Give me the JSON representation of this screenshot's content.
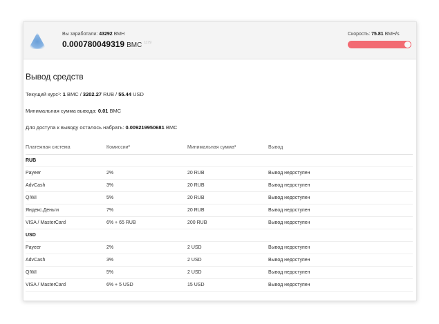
{
  "header": {
    "earned_label": "Вы заработали:",
    "earned_value": "43292",
    "earned_unit": "BMH",
    "balance_value": "0.000780049319",
    "balance_unit": "BMC",
    "balance_sup": "1179",
    "speed_label": "Скорость:",
    "speed_value": "75.81",
    "speed_unit": "BMH/s",
    "speed_bar_color": "#f26a72"
  },
  "page": {
    "title": "Вывод средств",
    "rate_label": "Текущий курс¹:",
    "rate_bmc": "1",
    "rate_bmc_unit": "BMC /",
    "rate_rub": "3202.27",
    "rate_rub_unit": "RUB /",
    "rate_usd": "55.44",
    "rate_usd_unit": "USD",
    "min_label": "Минимальная сумма вывода:",
    "min_value": "0.01",
    "min_unit": "BMC",
    "remain_label": "Для доступа к выводу осталось набрать:",
    "remain_value": "0.009219950681",
    "remain_unit": "BMC"
  },
  "table": {
    "headers": [
      "Платежная система",
      "Комиссии²",
      "Минимальная сумма³",
      "Вывод"
    ],
    "groups": [
      {
        "name": "RUB",
        "rows": [
          [
            "Payeer",
            "2%",
            "20 RUB",
            "Вывод недоступен"
          ],
          [
            "AdvCash",
            "3%",
            "20 RUB",
            "Вывод недоступен"
          ],
          [
            "QIWI",
            "5%",
            "20 RUB",
            "Вывод недоступен"
          ],
          [
            "Яндекс.Деньги",
            "7%",
            "20 RUB",
            "Вывод недоступен"
          ],
          [
            "VISA / MasterCard",
            "6% + 65 RUB",
            "200 RUB",
            "Вывод недоступен"
          ]
        ]
      },
      {
        "name": "USD",
        "rows": [
          [
            "Payeer",
            "2%",
            "2 USD",
            "Вывод недоступен"
          ],
          [
            "AdvCash",
            "3%",
            "2 USD",
            "Вывод недоступен"
          ],
          [
            "QIWI",
            "5%",
            "2 USD",
            "Вывод недоступен"
          ],
          [
            "VISA / MasterCard",
            "6% + 5 USD",
            "15 USD",
            "Вывод недоступен"
          ]
        ]
      }
    ]
  }
}
